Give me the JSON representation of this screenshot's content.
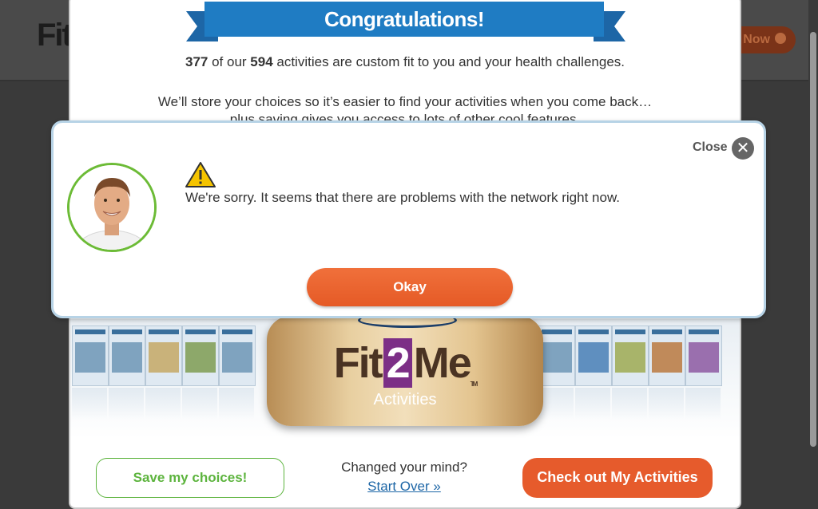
{
  "background": {
    "logo_text": "Fit",
    "cta_label": "Now"
  },
  "congrats": {
    "title": "Congratulations!",
    "custom_count": "377",
    "total_count": "594",
    "line1_pre": " of our ",
    "line1_post": " activities are custom fit to you and your health challenges.",
    "line2": "We’ll store your choices so it’s easier to find your activities when you come back…",
    "line3": "plus saving gives you access to lots of other cool features.",
    "badge_brand_left": "Fit",
    "badge_brand_num": "2",
    "badge_brand_right": "Me",
    "badge_tm": "TM",
    "badge_subtitle": "Activities",
    "save_button": "Save my choices!",
    "changed_mind": "Changed your mind?",
    "start_over": "Start Over »",
    "check_out_button": "Check out My Activities"
  },
  "dialog": {
    "close_label": "Close",
    "close_icon": "close-x-icon",
    "warning_icon": "warning-triangle-icon",
    "message": "We're sorry. It seems that there are problems with the network right now.",
    "okay_button": "Okay"
  },
  "colors": {
    "accent_orange": "#e65b2c",
    "accent_green": "#5db43e",
    "ribbon_blue": "#1f7cc3",
    "dialog_border": "#b7d3e6"
  }
}
